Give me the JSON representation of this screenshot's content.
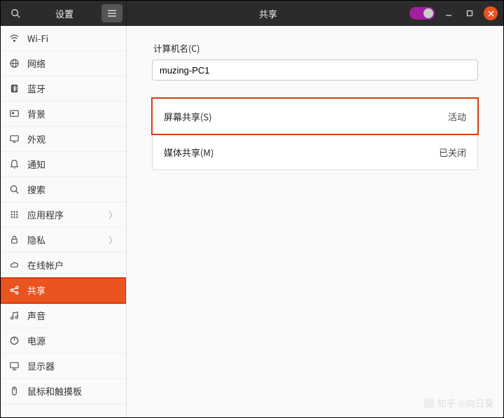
{
  "titlebar": {
    "left_title": "设置",
    "center_title": "共享"
  },
  "sidebar": {
    "items": [
      {
        "icon": "wifi",
        "label": "Wi-Fi"
      },
      {
        "icon": "globe",
        "label": "网络"
      },
      {
        "icon": "bluetooth",
        "label": "蓝牙"
      },
      {
        "icon": "background",
        "label": "背景"
      },
      {
        "icon": "appearance",
        "label": "外观"
      },
      {
        "icon": "bell",
        "label": "通知"
      },
      {
        "icon": "search",
        "label": "搜索"
      },
      {
        "icon": "apps",
        "label": "应用程序",
        "chevron": true
      },
      {
        "icon": "lock",
        "label": "隐私",
        "chevron": true
      },
      {
        "icon": "cloud",
        "label": "在线帐户"
      },
      {
        "icon": "share",
        "label": "共享",
        "active": true,
        "hl": true
      },
      {
        "icon": "music",
        "label": "声音"
      },
      {
        "icon": "power",
        "label": "电源"
      },
      {
        "icon": "display",
        "label": "显示器"
      },
      {
        "icon": "mouse",
        "label": "鼠标和触摸板"
      }
    ]
  },
  "content": {
    "hostname_label": "计算机名(C)",
    "hostname_value": "muzing-PC1",
    "rows": [
      {
        "label": "屏幕共享(S)",
        "status": "活动",
        "hl": true
      },
      {
        "label": "媒体共享(M)",
        "status": "已关闭"
      }
    ]
  },
  "watermark": "知乎 @向日葵"
}
